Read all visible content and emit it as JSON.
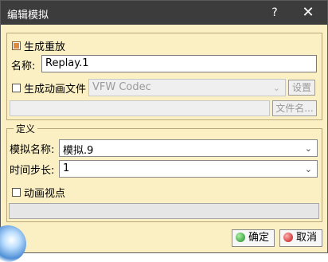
{
  "titlebar": {
    "title": "编辑模拟",
    "help_glyph": "?",
    "close_glyph": "✕"
  },
  "group1": {
    "generate_replay": {
      "label": "生成重放",
      "checked": true
    },
    "name_label": "名称:",
    "name_value": "Replay.1",
    "generate_anim": {
      "label": "生成动画文件",
      "checked": false
    },
    "codec_value": "VFW Codec",
    "settings_label": "设置",
    "filename_label": "文件名..."
  },
  "group2": {
    "legend": "定义",
    "sim_name_label": "模拟名称:",
    "sim_name_value": "模拟.9",
    "time_step_label": "时间步长:",
    "time_step_value": "1",
    "anim_viewpoint": {
      "label": "动画视点",
      "checked": false
    }
  },
  "footer": {
    "ok_label": "确定",
    "cancel_label": "取消"
  },
  "icons": {
    "chevron": "⌄"
  }
}
